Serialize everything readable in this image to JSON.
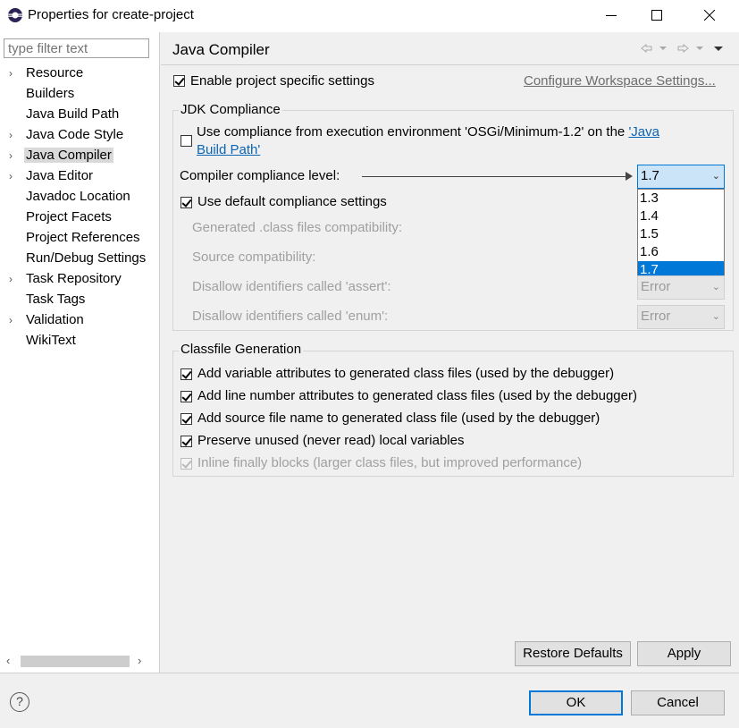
{
  "window": {
    "title": "Properties for create-project",
    "minimize_icon": "minimize-icon",
    "maximize_icon": "maximize-icon",
    "close_icon": "close-icon"
  },
  "sidebar": {
    "filter_placeholder": "type filter text",
    "items": [
      {
        "label": "Resource",
        "expandable": true
      },
      {
        "label": "Builders",
        "expandable": false
      },
      {
        "label": "Java Build Path",
        "expandable": false
      },
      {
        "label": "Java Code Style",
        "expandable": true
      },
      {
        "label": "Java Compiler",
        "expandable": true,
        "selected": true
      },
      {
        "label": "Java Editor",
        "expandable": true
      },
      {
        "label": "Javadoc Location",
        "expandable": false
      },
      {
        "label": "Project Facets",
        "expandable": false
      },
      {
        "label": "Project References",
        "expandable": false
      },
      {
        "label": "Run/Debug Settings",
        "expandable": false
      },
      {
        "label": "Task Repository",
        "expandable": true
      },
      {
        "label": "Task Tags",
        "expandable": false
      },
      {
        "label": "Validation",
        "expandable": true
      },
      {
        "label": "WikiText",
        "expandable": false
      }
    ]
  },
  "page": {
    "title": "Java Compiler",
    "enable_project_settings": "Enable project specific settings",
    "configure_workspace_link": "Configure Workspace Settings...",
    "jdk": {
      "group_title": "JDK Compliance",
      "use_ee_part1": "Use compliance from execution environment 'OSGi/Minimum-1.2' on the ",
      "use_ee_link1": "'Java",
      "use_ee_link2": "Build Path'",
      "compliance_label": "Compiler compliance level:",
      "compliance_value": "1.7",
      "compliance_options": [
        "1.3",
        "1.4",
        "1.5",
        "1.6",
        "1.7"
      ],
      "use_default": "Use default compliance settings",
      "generated_class": "Generated .class files compatibility:",
      "source_compat": "Source compatibility:",
      "disallow_assert": "Disallow identifiers called 'assert':",
      "disallow_assert_value": "Error",
      "disallow_enum": "Disallow identifiers called 'enum':",
      "disallow_enum_value": "Error"
    },
    "classfile": {
      "group_title": "Classfile Generation",
      "options": [
        {
          "label": "Add variable attributes to generated class files (used by the debugger)",
          "checked": true,
          "enabled": true
        },
        {
          "label": "Add line number attributes to generated class files (used by the debugger)",
          "checked": true,
          "enabled": true
        },
        {
          "label": "Add source file name to generated class file (used by the debugger)",
          "checked": true,
          "enabled": true
        },
        {
          "label": "Preserve unused (never read) local variables",
          "checked": true,
          "enabled": true
        },
        {
          "label": "Inline finally blocks (larger class files, but improved performance)",
          "checked": true,
          "enabled": false
        }
      ]
    },
    "restore_defaults": "Restore Defaults",
    "apply": "Apply"
  },
  "footer": {
    "help_icon": "help-icon",
    "ok": "OK",
    "cancel": "Cancel"
  },
  "colors": {
    "accent": "#0078d7",
    "link": "#0b64b4",
    "selection": "#cce4f7"
  }
}
